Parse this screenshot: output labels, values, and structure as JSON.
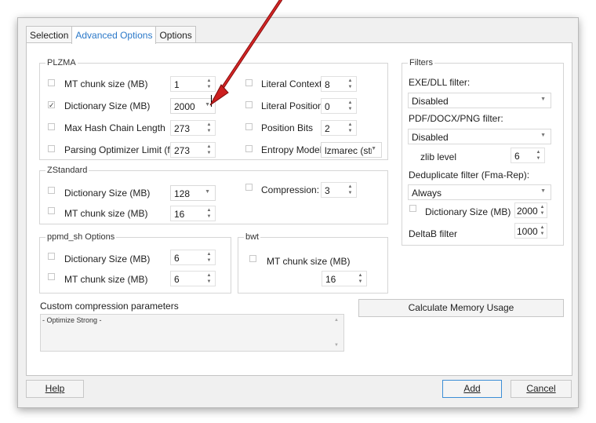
{
  "tabs": [
    "Selection",
    "Advanced Options",
    "Options"
  ],
  "plzma": {
    "title": "PLZMA",
    "mt_chunk": {
      "label": "MT chunk size (MB)",
      "value": "1",
      "checked": false
    },
    "dict": {
      "label": "Dictionary Size (MB)",
      "value": "2000",
      "checked": true
    },
    "hash": {
      "label": "Max Hash Chain Length",
      "value": "273",
      "checked": false
    },
    "parse": {
      "label": "Parsing Optimizer Limit (fb)",
      "value": "273",
      "checked": false
    },
    "lit_ctx": {
      "label": "Literal Context",
      "value": "8",
      "checked": false
    },
    "lit_pos": {
      "label": "Literal Position",
      "value": "0",
      "checked": false
    },
    "pos_bits": {
      "label": "Position Bits",
      "value": "2",
      "checked": false
    },
    "entropy": {
      "label": "Entropy Model",
      "value": "lzmarec (strc",
      "checked": false
    }
  },
  "zstd": {
    "title": "ZStandard",
    "dict": {
      "label": "Dictionary Size (MB)",
      "value": "128",
      "checked": false
    },
    "mt_chunk": {
      "label": "MT chunk size (MB)",
      "value": "16",
      "checked": false
    },
    "comp": {
      "label": "Compression:",
      "value": "3",
      "checked": false
    }
  },
  "ppmd": {
    "title": "ppmd_sh Options",
    "dict": {
      "label": "Dictionary Size (MB)",
      "value": "6",
      "checked": false
    },
    "mt_chunk": {
      "label": "MT chunk size (MB)",
      "value": "6",
      "checked": false
    }
  },
  "bwt": {
    "title": "bwt",
    "mt_chunk": {
      "label": "MT chunk size (MB)",
      "value": "16",
      "checked": false
    }
  },
  "filters": {
    "title": "Filters",
    "exe_label": "EXE/DLL filter:",
    "exe_value": "Disabled",
    "pdf_label": "PDF/DOCX/PNG filter:",
    "pdf_value": "Disabled",
    "zlib_label": "zlib level",
    "zlib_value": "6",
    "dedup_label": "Deduplicate filter (Fma-Rep):",
    "dedup_value": "Always",
    "dedup_dict_label": "Dictionary Size (MB)",
    "dedup_dict_value": "2000",
    "dedup_dict_checked": false,
    "delta_label": "DeltaB filter",
    "delta_value": "1000"
  },
  "custom": {
    "label": "Custom compression parameters",
    "value": "- Optimize Strong -"
  },
  "calc_button": "Calculate Memory Usage",
  "help_button": "Help",
  "add_button": "Add",
  "cancel_button": "Cancel",
  "icons": {
    "check": "checkmark-icon",
    "spin_arrows": "spin-arrows-icon",
    "dropdown": "chevron-down-icon"
  },
  "annotation_color": "#cc1f1f"
}
